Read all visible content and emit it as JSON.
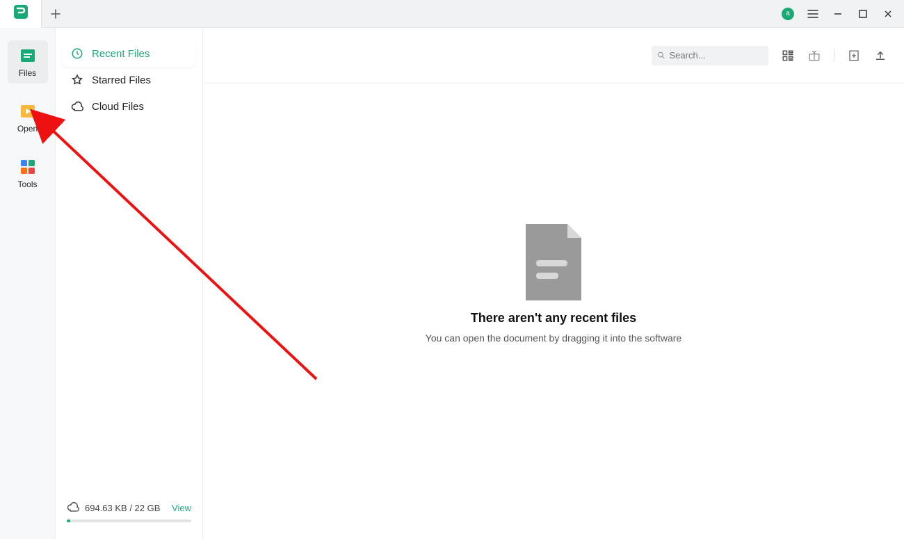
{
  "titlebar": {
    "avatar_initial": "a"
  },
  "sidebar_nav": {
    "items": [
      {
        "label": "Files"
      },
      {
        "label": "Open"
      },
      {
        "label": "Tools"
      }
    ]
  },
  "sidebar_cats": {
    "items": [
      {
        "label": "Recent Files"
      },
      {
        "label": "Starred Files"
      },
      {
        "label": "Cloud Files"
      }
    ]
  },
  "storage": {
    "usage_text": "694.63 KB / 22 GB",
    "view_label": "View"
  },
  "search": {
    "placeholder": "Search..."
  },
  "empty_state": {
    "title": "There aren't any recent files",
    "subtitle": "You can open the document by dragging it into the software"
  }
}
